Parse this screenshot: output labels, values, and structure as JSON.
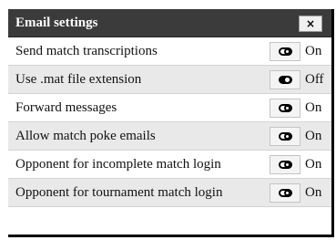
{
  "dialog": {
    "title": "Email settings",
    "close_label": "×"
  },
  "settings": [
    {
      "label": "Send match transcriptions",
      "state": "On"
    },
    {
      "label": "Use .mat file extension",
      "state": "Off"
    },
    {
      "label": "Forward messages",
      "state": "On"
    },
    {
      "label": "Allow match poke emails",
      "state": "On"
    },
    {
      "label": "Opponent for incomplete match login",
      "state": "On"
    },
    {
      "label": "Opponent for tournament match login",
      "state": "On"
    }
  ],
  "colors": {
    "header_bg": "#3b3b3b",
    "header_text": "#ffffff",
    "alt_row_bg": "#e9e9e9"
  },
  "icons": {
    "toggle_on": "toggle-on-icon",
    "toggle_off": "toggle-off-icon",
    "close": "close-icon"
  }
}
